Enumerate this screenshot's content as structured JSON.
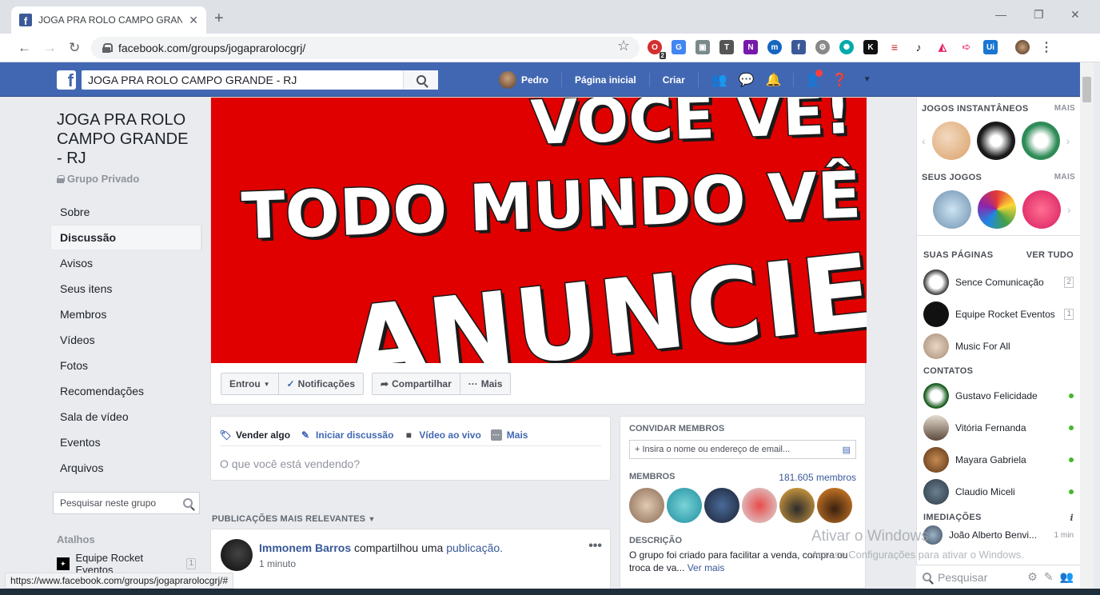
{
  "browser": {
    "tab_title": "JOGA PRA ROLO CAMPO GRANDE",
    "url": "facebook.com/groups/jogaprarolocgrj/",
    "status_url": "https://www.facebook.com/groups/jogaprarolocgrj/#",
    "ext_badge": "2"
  },
  "topbar": {
    "search_value": "JOGA PRA ROLO CAMPO GRANDE - RJ",
    "user": "Pedro",
    "home": "Página inicial",
    "create": "Criar"
  },
  "group": {
    "name": "JOGA PRA ROLO CAMPO GRANDE - RJ",
    "privacy": "Grupo Privado",
    "menu": [
      "Sobre",
      "Discussão",
      "Avisos",
      "Seus itens",
      "Membros",
      "Vídeos",
      "Fotos",
      "Recomendações",
      "Sala de vídeo",
      "Eventos",
      "Arquivos"
    ],
    "search_placeholder": "Pesquisar neste grupo",
    "shortcuts_title": "Atalhos",
    "shortcut": "Equipe Rocket Eventos",
    "shortcut_count": "1"
  },
  "cover": {
    "line1": "VOCÊ VÊ!",
    "line2": "TODO MUNDO VÊ!",
    "line3": "ANUNCIE"
  },
  "actions": {
    "joined": "Entrou",
    "notifications": "Notificações",
    "share": "Compartilhar",
    "more": "Mais"
  },
  "composer": {
    "sell": "Vender algo",
    "discuss": "Iniciar discussão",
    "live": "Vídeo ao vivo",
    "more": "Mais",
    "placeholder": "O que você está vendendo?"
  },
  "feed": {
    "header": "PUBLICAÇÕES MAIS RELEVANTES",
    "author": "Immonem Barros",
    "shared": "compartilhou uma",
    "link": "publicação.",
    "time": "1 minuto"
  },
  "info": {
    "invite_title": "CONVIDAR MEMBROS",
    "invite_placeholder": "Insira o nome ou endereço de email...",
    "members_title": "MEMBROS",
    "members_count": "181.605 membros",
    "desc_title": "DESCRIÇÃO",
    "desc_text": "O grupo foi criado para facilitar a venda, compra ou troca de va...",
    "see_more": "Ver mais"
  },
  "sidebar": {
    "instant_games": "JOGOS INSTANTÂNEOS",
    "your_games": "SEUS JOGOS",
    "more": "MAIS",
    "pages_title": "SUAS PÁGINAS",
    "see_all": "VER TUDO",
    "pages": [
      {
        "name": "Sence Comunicação",
        "count": "2"
      },
      {
        "name": "Equipe Rocket Eventos",
        "count": "1"
      },
      {
        "name": "Music For All",
        "count": ""
      }
    ],
    "contacts_title": "CONTATOS",
    "contacts": [
      "Gustavo Felicidade",
      "Vitória Fernanda",
      "Mayara Gabriela",
      "Claudio Miceli"
    ],
    "nearby_title": "IMEDIAÇÕES",
    "nearby": "João Alberto Benvi...",
    "nearby_time": "1 min",
    "search": "Pesquisar"
  },
  "watermark": {
    "title": "Ativar o Windows",
    "subtitle": "Acesse Configurações para ativar o Windows."
  }
}
